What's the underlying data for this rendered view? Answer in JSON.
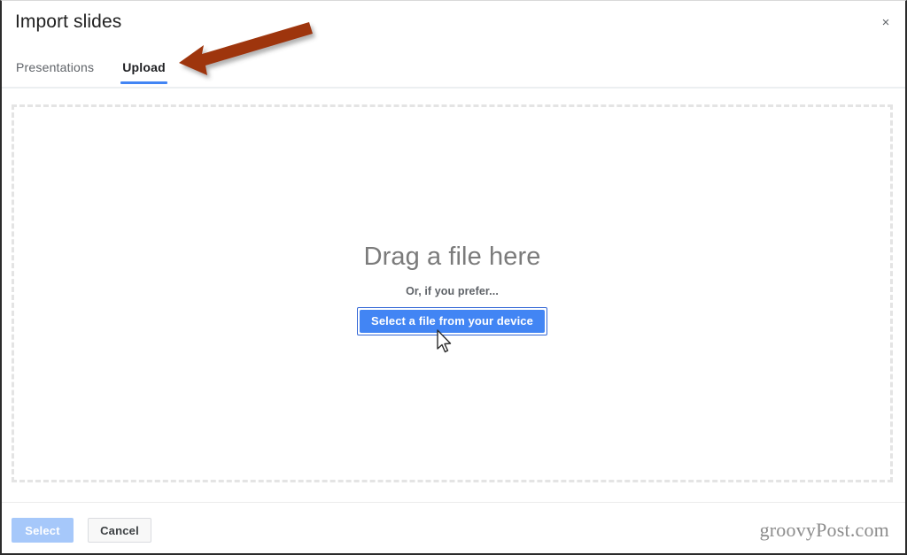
{
  "window": {
    "title": "Import slides",
    "close_label": "×"
  },
  "tabs": [
    {
      "label": "Presentations",
      "active": false
    },
    {
      "label": "Upload",
      "active": true
    }
  ],
  "dropzone": {
    "drag_title": "Drag a file here",
    "or_text": "Or, if you prefer...",
    "select_file_label": "Select a file from your device"
  },
  "footer": {
    "select_label": "Select",
    "cancel_label": "Cancel",
    "watermark": "groovyPost.com"
  },
  "colors": {
    "accent_blue": "#4285f4",
    "button_focus_border": "#3367d6",
    "select_disabled": "#a6c8fa",
    "annotation_arrow": "#9e3409",
    "tab_inactive_text": "#5f6368",
    "tab_active_text": "#202124",
    "drag_title_text": "#7b7b7b",
    "dropzone_border": "#e4e4e4",
    "watermark_text": "#8c8c8c"
  },
  "icons": {
    "close": "close-icon",
    "annotation_arrow": "arrow-left-annotation-icon",
    "cursor": "mouse-cursor-icon"
  }
}
